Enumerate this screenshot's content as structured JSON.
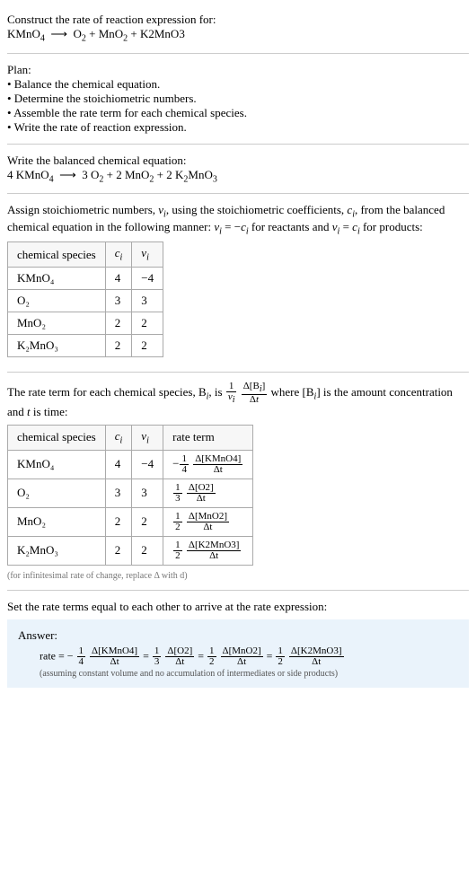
{
  "intro": {
    "title": "Construct the rate of reaction expression for:",
    "equation_lhs": "KMnO",
    "equation_arrow": "⟶",
    "equation_rhs_1": "O",
    "equation_plus1": " + MnO",
    "equation_plus2": " + K2MnO3"
  },
  "plan": {
    "heading": "Plan:",
    "b1": "• Balance the chemical equation.",
    "b2": "• Determine the stoichiometric numbers.",
    "b3": "• Assemble the rate term for each chemical species.",
    "b4": "• Write the rate of reaction expression."
  },
  "balanced": {
    "heading": "Write the balanced chemical equation:",
    "c1": "4 KMnO",
    "arrow": "⟶",
    "c2": "3 O",
    "c3": " + 2 MnO",
    "c4": " + 2 K",
    "c5": "MnO"
  },
  "assign": {
    "text1": "Assign stoichiometric numbers, ",
    "nu": "ν",
    "text2": ", using the stoichiometric coefficients, ",
    "c": "c",
    "text3": ", from the balanced chemical equation in the following manner: ",
    "eq1": " = −",
    "text4": " for reactants and ",
    "eq2": " = ",
    "text5": " for products:"
  },
  "table1": {
    "h1": "chemical species",
    "h2": "cᵢ",
    "h3": "νᵢ",
    "rows": [
      {
        "sp": "KMnO₄",
        "c": "4",
        "v": "−4"
      },
      {
        "sp": "O₂",
        "c": "3",
        "v": "3"
      },
      {
        "sp": "MnO₂",
        "c": "2",
        "v": "2"
      },
      {
        "sp": "K₂MnO₃",
        "c": "2",
        "v": "2"
      }
    ]
  },
  "rateterm": {
    "text1": "The rate term for each chemical species, B",
    "text2": ", is ",
    "text3": " where [B",
    "text4": "] is the amount concentration and ",
    "tvar": "t",
    "text5": " is time:"
  },
  "table2": {
    "h1": "chemical species",
    "h2": "cᵢ",
    "h3": "νᵢ",
    "h4": "rate term",
    "rows": [
      {
        "sp": "KMnO₄",
        "c": "4",
        "v": "−4",
        "sign": "−",
        "coef_num": "1",
        "coef_den": "4",
        "dnum": "Δ[KMnO4]",
        "dden": "Δt"
      },
      {
        "sp": "O₂",
        "c": "3",
        "v": "3",
        "sign": "",
        "coef_num": "1",
        "coef_den": "3",
        "dnum": "Δ[O2]",
        "dden": "Δt"
      },
      {
        "sp": "MnO₂",
        "c": "2",
        "v": "2",
        "sign": "",
        "coef_num": "1",
        "coef_den": "2",
        "dnum": "Δ[MnO2]",
        "dden": "Δt"
      },
      {
        "sp": "K₂MnO₃",
        "c": "2",
        "v": "2",
        "sign": "",
        "coef_num": "1",
        "coef_den": "2",
        "dnum": "Δ[K2MnO3]",
        "dden": "Δt"
      }
    ]
  },
  "infinitesimal": "(for infinitesimal rate of change, replace Δ with d)",
  "setequal": "Set the rate terms equal to each other to arrive at the rate expression:",
  "answer": {
    "label": "Answer:",
    "prefix": "rate = −",
    "t1n": "1",
    "t1d": "4",
    "d1n": "Δ[KMnO4]",
    "d1d": "Δt",
    "eq": " = ",
    "t2n": "1",
    "t2d": "3",
    "d2n": "Δ[O2]",
    "d2d": "Δt",
    "t3n": "1",
    "t3d": "2",
    "d3n": "Δ[MnO2]",
    "d3d": "Δt",
    "t4n": "1",
    "t4d": "2",
    "d4n": "Δ[K2MnO3]",
    "d4d": "Δt",
    "note": "(assuming constant volume and no accumulation of intermediates or side products)"
  },
  "chart_data": {
    "type": "table",
    "title": "Stoichiometric numbers and rate terms",
    "tables": [
      {
        "columns": [
          "chemical species",
          "c_i",
          "ν_i"
        ],
        "rows": [
          [
            "KMnO4",
            4,
            -4
          ],
          [
            "O2",
            3,
            3
          ],
          [
            "MnO2",
            2,
            2
          ],
          [
            "K2MnO3",
            2,
            2
          ]
        ]
      },
      {
        "columns": [
          "chemical species",
          "c_i",
          "ν_i",
          "rate term"
        ],
        "rows": [
          [
            "KMnO4",
            4,
            -4,
            "-(1/4) Δ[KMnO4]/Δt"
          ],
          [
            "O2",
            3,
            3,
            "(1/3) Δ[O2]/Δt"
          ],
          [
            "MnO2",
            2,
            2,
            "(1/2) Δ[MnO2]/Δt"
          ],
          [
            "K2MnO3",
            2,
            2,
            "(1/2) Δ[K2MnO3]/Δt"
          ]
        ]
      }
    ],
    "rate_expression": "rate = -(1/4) Δ[KMnO4]/Δt = (1/3) Δ[O2]/Δt = (1/2) Δ[MnO2]/Δt = (1/2) Δ[K2MnO3]/Δt"
  }
}
